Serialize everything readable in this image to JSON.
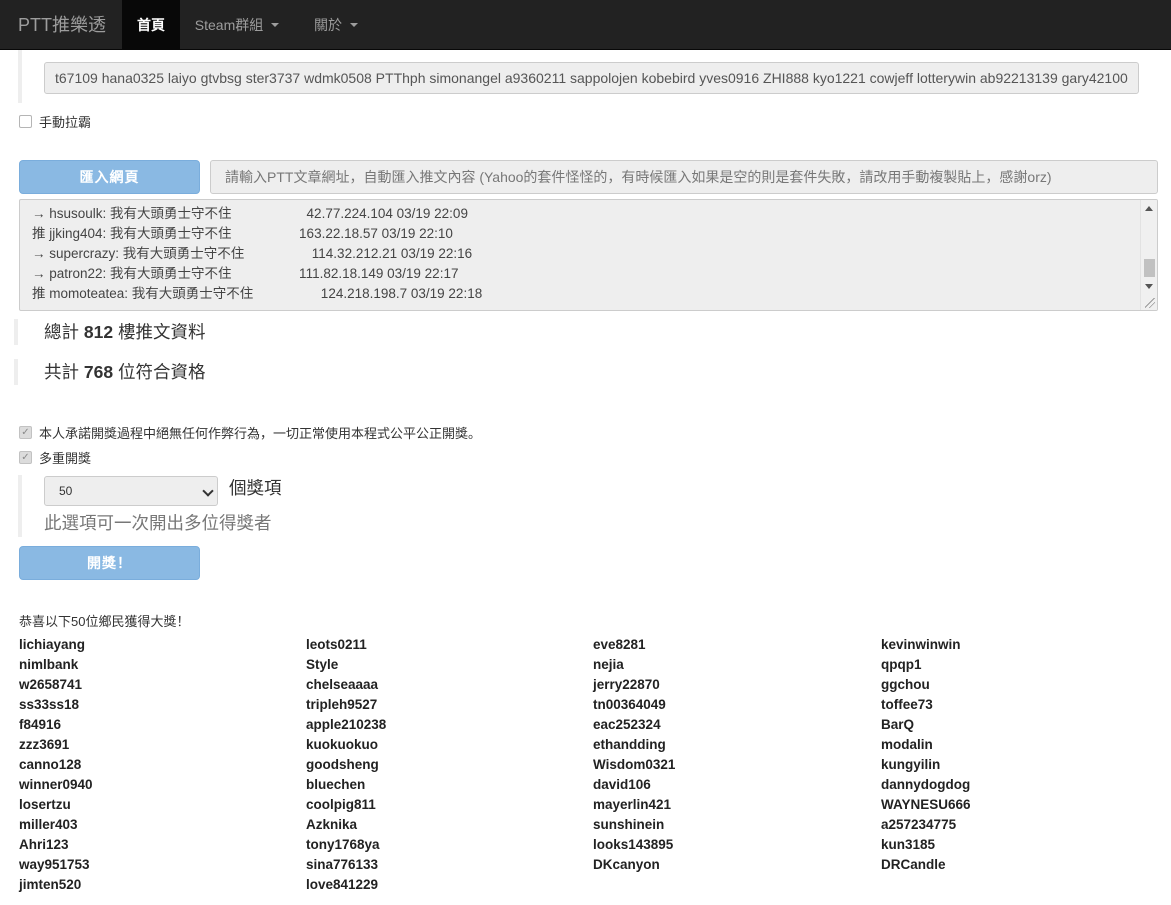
{
  "navbar": {
    "brand": "PTT推樂透",
    "items": [
      {
        "label": "首頁",
        "active": true
      },
      {
        "label": "Steam群組",
        "active": false
      },
      {
        "label": "關於",
        "active": false
      }
    ]
  },
  "names_input": {
    "value": "t67109 hana0325 laiyo gtvbsg ster3737 wdmk0508 PTThph simonangel a9360211 sappolojen kobebird yves0916 ZHI888 kyo1221 cowjeff lotterywin ab92213139 gary42100"
  },
  "manual_pull": {
    "label": "手動拉霸",
    "checked": false
  },
  "import_button": {
    "label": "匯入網頁"
  },
  "url_input": {
    "placeholder": "請輸入PTT文章網址，自動匯入推文內容 (Yahoo的套件怪怪的，有時候匯入如果是空的則是套件失敗，請改用手動複製貼上，感謝orz)"
  },
  "push_lines": [
    "→ hsusoulk: 我有大頭勇士守不住                    42.77.224.104 03/19 22:09",
    "推 jjking404: 我有大頭勇士守不住                  163.22.18.57 03/19 22:10",
    "→ supercrazy: 我有大頭勇士守不住                  114.32.212.21 03/19 22:16",
    "→ patron22: 我有大頭勇士守不住                  111.82.18.149 03/19 22:17",
    "推 momoteatea: 我有大頭勇士守不住                  124.218.198.7 03/19 22:18"
  ],
  "stats": {
    "total_prefix": "總計 ",
    "total_value": "812",
    "total_suffix": " 樓推文資料",
    "eligible_prefix": "共計 ",
    "eligible_value": "768",
    "eligible_suffix": " 位符合資格"
  },
  "pledge": {
    "label": "本人承諾開獎過程中絕無任何作弊行為，一切正常使用本程式公平公正開獎。",
    "checked": true
  },
  "multi_draw": {
    "label": "多重開獎",
    "checked": true
  },
  "prize_select": {
    "value": "50",
    "suffix": "個獎項",
    "help": "此選項可一次開出多位得獎者"
  },
  "draw_button": {
    "label": "開獎！"
  },
  "congrats": "恭喜以下50位鄉民獲得大獎！",
  "winners": [
    [
      "lichiayang",
      "nimlbank",
      "w2658741",
      "ss33ss18",
      "f84916",
      "zzz3691",
      "canno128",
      "winner0940",
      "losertzu",
      "miller403",
      "Ahri123",
      "way951753",
      "jimten520"
    ],
    [
      "leots0211",
      "Style",
      "chelseaaaa",
      "tripleh9527",
      "apple210238",
      "kuokuokuo",
      "goodsheng",
      "bluechen",
      "coolpig811",
      "Azknika",
      "tony1768ya",
      "sina776133",
      "love841229"
    ],
    [
      "eve8281",
      "nejia",
      "jerry22870",
      "tn00364049",
      "eac252324",
      "ethandding",
      "Wisdom0321",
      "david106",
      "mayerlin421",
      "sunshinein",
      "looks143895",
      "DKcanyon"
    ],
    [
      "kevinwinwin",
      "qpqp1",
      "ggchou",
      "toffee73",
      "BarQ",
      "modalin",
      "kungyilin",
      "dannydogdog",
      "WAYNESU666",
      "a257234775",
      "kun3185",
      "DRCandle"
    ]
  ]
}
